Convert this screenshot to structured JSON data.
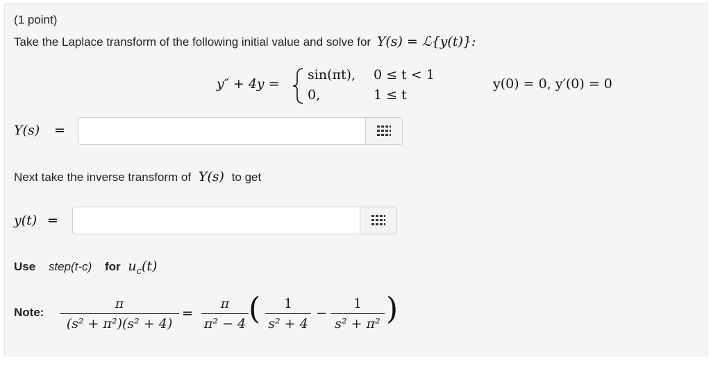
{
  "problem": {
    "points": "(1 point)",
    "intro": "Take the Laplace transform of the following initial value and solve for",
    "intro_math": "Y(s) = ℒ{y(t)}:",
    "equation_lhs": "y″ + 4y =",
    "case1_expr": "sin(πt),",
    "case1_cond": "0 ≤ t < 1",
    "case2_expr": "0,",
    "case2_cond": "1 ≤ t",
    "initial_conditions": "y(0) = 0,  y′(0) = 0"
  },
  "answer1": {
    "label": "Y(s)",
    "equals": "=",
    "value": "",
    "placeholder": ""
  },
  "middle": {
    "text": "Next take the inverse transform of",
    "math": "Y(s)",
    "suffix": "to get"
  },
  "answer2": {
    "label": "y(t)",
    "equals": "=",
    "value": "",
    "placeholder": ""
  },
  "hint": {
    "use": "Use",
    "step": "step(t-c)",
    "for": "for",
    "uc": "u",
    "uc_sub": "c",
    "uc_arg": "(t)"
  },
  "note": {
    "label": "Note:",
    "f1_num": "π",
    "f1_den": "(s² + π²)(s² + 4)",
    "equals": "=",
    "f2_num": "π",
    "f2_den": "π² − 4",
    "lparen": "(",
    "f3_num": "1",
    "f3_den": "s² + 4",
    "minus": "−",
    "f4_num": "1",
    "f4_den": "s² + π²",
    "rparen": ")"
  },
  "icons": {
    "equation_editor": "grid-icon"
  }
}
